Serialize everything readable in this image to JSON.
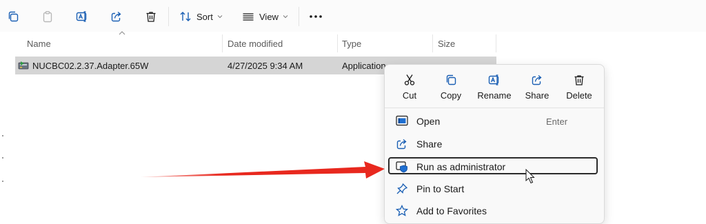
{
  "toolbar": {
    "sort_label": "Sort",
    "view_label": "View",
    "icons": [
      "copy-icon",
      "paste-icon",
      "rename-icon",
      "share-icon",
      "delete-icon",
      "sort-icon",
      "view-icon",
      "more-icon"
    ]
  },
  "columns": {
    "name": "Name",
    "date_modified": "Date modified",
    "type": "Type",
    "size": "Size"
  },
  "file": {
    "name": "NUCBC02.2.37.Adapter.65W",
    "date_modified": "4/27/2025 9:34 AM",
    "type": "Application",
    "icon": "installer-icon"
  },
  "context_menu": {
    "quick_actions": [
      {
        "label": "Cut",
        "icon": "scissors-icon"
      },
      {
        "label": "Copy",
        "icon": "copy-icon"
      },
      {
        "label": "Rename",
        "icon": "rename-icon"
      },
      {
        "label": "Share",
        "icon": "share-icon"
      },
      {
        "label": "Delete",
        "icon": "trash-icon"
      }
    ],
    "items": [
      {
        "label": "Open",
        "shortcut": "Enter",
        "icon": "open-window-icon"
      },
      {
        "label": "Share",
        "icon": "share-icon"
      },
      {
        "label": "Run as administrator",
        "icon": "shield-icon",
        "highlighted": true
      },
      {
        "label": "Pin to Start",
        "icon": "pin-icon"
      },
      {
        "label": "Add to Favorites",
        "icon": "star-icon"
      }
    ]
  },
  "colors": {
    "selected_row": "#d5d5d5",
    "highlight_border": "#2b2b2b",
    "annotation_arrow": "#e8281e",
    "shield_blue": "#1f6fd1"
  }
}
